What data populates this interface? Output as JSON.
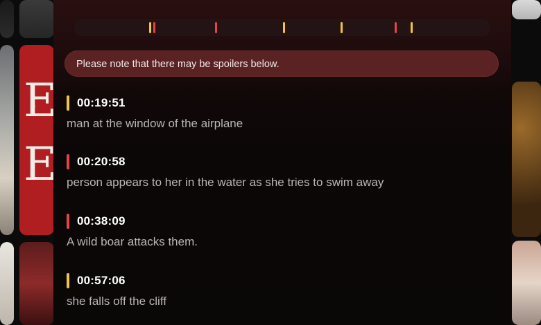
{
  "colors": {
    "yellow_marker": "#f2c53d",
    "red_marker": "#e0464b",
    "notice_bg": "#5a2222",
    "panel_bg": "#0a0707"
  },
  "timeline": {
    "markers": [
      {
        "time": "00:19:51",
        "severity": "yellow",
        "color": "#f2c53d"
      },
      {
        "time": "00:20:58",
        "severity": "red",
        "color": "#e0464b"
      },
      {
        "time": "00:38:09",
        "severity": "red",
        "color": "#e0464b"
      },
      {
        "time": "00:57:06",
        "severity": "yellow",
        "color": "#f2c53d"
      },
      {
        "time": "",
        "severity": "yellow",
        "color": "#f2c53d"
      },
      {
        "time": "",
        "severity": "red",
        "color": "#e0464b"
      },
      {
        "time": "",
        "severity": "yellow",
        "color": "#f2c53d"
      }
    ]
  },
  "notice": {
    "text": "Please note that there may be spoilers below."
  },
  "entries": [
    {
      "time": "00:19:51",
      "description": "man at the window of the airplane",
      "severity": "yellow",
      "color": "#f2c53d"
    },
    {
      "time": "00:20:58",
      "description": "person appears to her in the water as she tries to swim away",
      "severity": "red",
      "color": "#e0464b"
    },
    {
      "time": "00:38:09",
      "description": "A wild boar attacks them.",
      "severity": "red",
      "color": "#e0464b"
    },
    {
      "time": "00:57:06",
      "description": "she falls off the cliff",
      "severity": "yellow",
      "color": "#f2c53d"
    }
  ]
}
